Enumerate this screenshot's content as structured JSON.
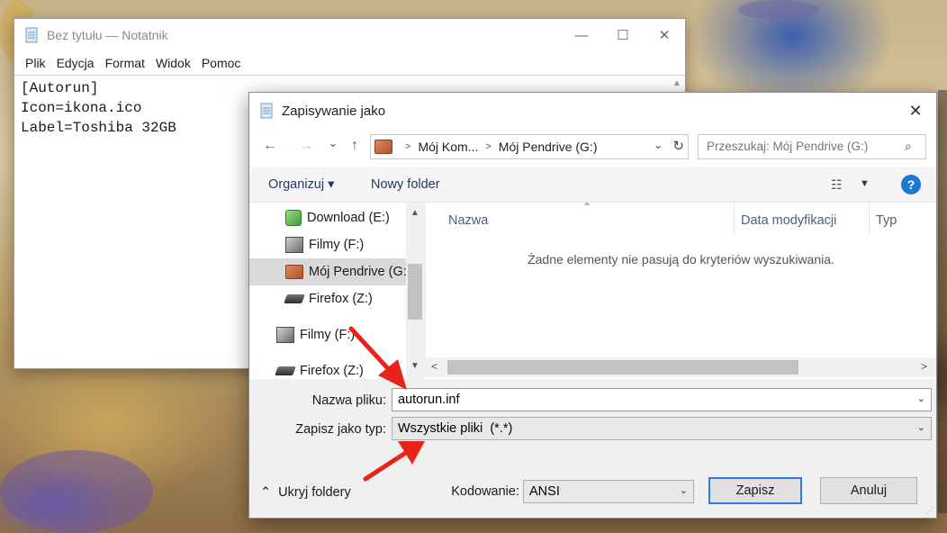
{
  "notepad": {
    "title": "Bez tytułu — Notatnik",
    "menu": [
      "Plik",
      "Edycja",
      "Format",
      "Widok",
      "Pomoc"
    ],
    "content_lines": [
      "[Autorun]",
      "Icon=ikona.ico",
      "Label=Toshiba 32GB"
    ],
    "controls": {
      "minimize": "—",
      "maximize": "☐",
      "close": "✕"
    }
  },
  "dialog": {
    "title": "Zapisywanie jako",
    "close": "✕",
    "nav": {
      "back": "←",
      "forward": "→",
      "recent": "⌄",
      "up": "↑"
    },
    "breadcrumb": [
      "Mój Kom...",
      "Mój Pendrive (G:)"
    ],
    "search_placeholder": "Przeszukaj: Mój Pendrive (G:)",
    "toolbar": {
      "organize": "Organizuj",
      "organize_caret": "▾",
      "new_folder": "Nowy folder",
      "help": "?"
    },
    "tree": [
      {
        "label": "Download (E:)",
        "icon": "green-drive",
        "selected": false
      },
      {
        "label": "Filmy (F:)",
        "icon": "grey-drive",
        "selected": false
      },
      {
        "label": "Mój Pendrive (G:)",
        "icon": "pendrive",
        "selected": true
      },
      {
        "label": "Firefox (Z:)",
        "icon": "disk",
        "selected": false
      },
      {
        "label": "Filmy (F:)",
        "icon": "grey-drive",
        "selected": false
      },
      {
        "label": "Firefox (Z:)",
        "icon": "disk",
        "selected": false
      }
    ],
    "columns": [
      "Nazwa",
      "Data modyfikacji",
      "Typ"
    ],
    "empty_message": "Żadne elementy nie pasują do kryteriów wyszukiwania.",
    "filename_label": "Nazwa pliku:",
    "filename_value": "autorun.inf",
    "filetype_label": "Zapisz jako typ:",
    "filetype_value": "Wszystkie pliki  (*.*)",
    "hide_folders": "Ukryj foldery",
    "encoding_label": "Kodowanie:",
    "encoding_value": "ANSI",
    "save": "Zapisz",
    "cancel": "Anuluj"
  },
  "colors": {
    "arrow": "#e8231b",
    "accent": "#2e7be0",
    "help": "#1e78d2"
  }
}
